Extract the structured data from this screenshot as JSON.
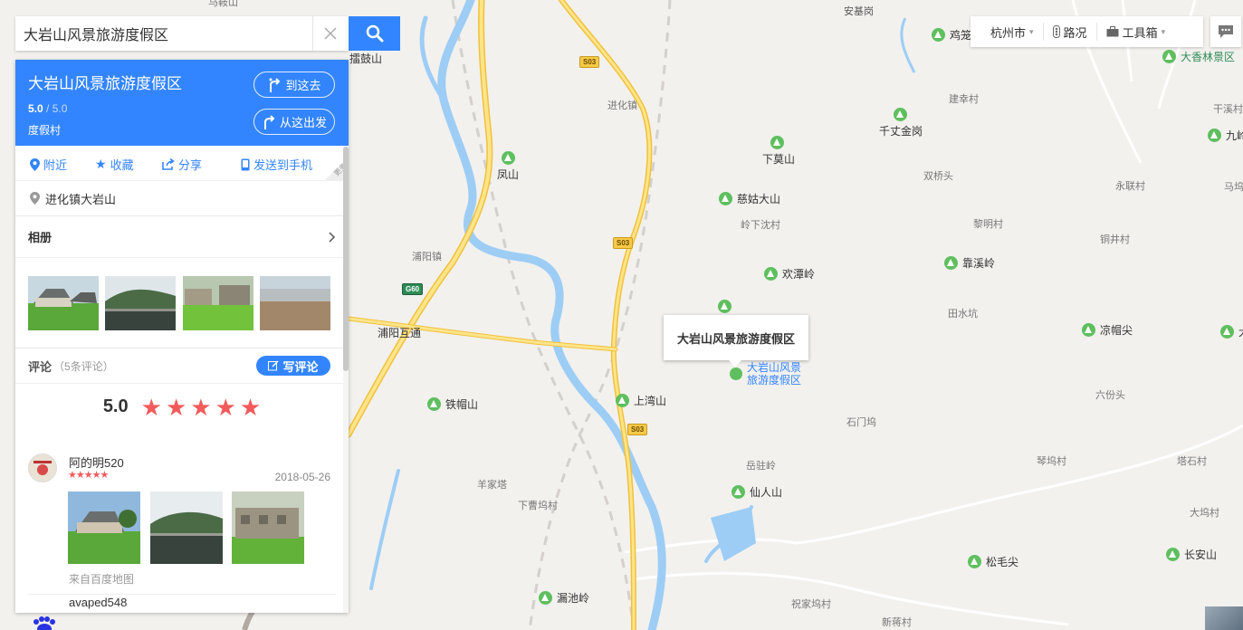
{
  "search": {
    "value": "大岩山风景旅游度假区"
  },
  "place": {
    "name": "大岩山风景旅游度假区",
    "score": "5.0",
    "score_max": "/ 5.0",
    "type": "度假村",
    "go_here": "到这去",
    "from_here": "从这出发",
    "address": "进化镇大岩山"
  },
  "actions": {
    "nearby": "附近",
    "favorite": "收藏",
    "share": "分享",
    "send_phone": "发送到手机",
    "more": "更多"
  },
  "album": {
    "title": "相册"
  },
  "comments": {
    "title": "评论",
    "count": "（5条评论）",
    "write": "写评论",
    "score": "5.0",
    "stars": 5,
    "items": [
      {
        "user": "阿的明520",
        "rating": 5,
        "date": "2018-05-26",
        "source": "来自百度地图"
      }
    ],
    "next_user": "avaped548"
  },
  "toolbar": {
    "city": "杭州市",
    "traffic": "路况",
    "tools": "工具箱"
  },
  "map": {
    "tooltip": "大岩山风景旅游度假区",
    "selected_line1": "大岩山风景",
    "selected_line2": "旅游度假区",
    "pois": {
      "fengshan": "凤山",
      "xiamoshan": "下莫山",
      "ciguda": "慈姑大山",
      "huantanling": "欢潭岭",
      "qianzhangjingang": "千丈金岗",
      "kaoxiling": "靠溪岭",
      "tiemaoshan": "铁帽山",
      "shangwanshan": "上湾山",
      "xianrenshan": "仙人山",
      "liangmaojian": "凉帽尖",
      "songmaojian": "松毛尖",
      "changanshan": "长安山",
      "louchiling": "漏池岭",
      "jilong": "鸡笼",
      "daxianglin": "大香林景区",
      "jiuling": "九岭",
      "east": "大"
    },
    "villages": {
      "jinhuazhen": "进化镇",
      "puyangzhen": "浦阳镇",
      "puyanghutong": "浦阳互通",
      "yangjiata": "羊家塔",
      "xiacaowucun": "下曹坞村",
      "lingxiachencun": "岭下沈村",
      "jianxingcun": "建幸村",
      "shuangqiaotou": "双桥头",
      "limingcun": "黎明村",
      "yongliancun": "永联村",
      "tongjingcun": "铜井村",
      "tianshuikeng": "田水坑",
      "liufentou": "六份头",
      "shimenwu": "石门坞",
      "yuezhuling": "岳驻岭",
      "qinwucun": "琴坞村",
      "tashicun": "塔石村",
      "dawucun": "大坞村",
      "zhujiawucun": "祝家坞村",
      "xinjiangcun": "新蒋村",
      "anjicun": "安基岗",
      "maanshan": "马鞍山",
      "leigushan": "擂鼓山",
      "ganxicun": "干溪村",
      "majiacun": "马坞"
    },
    "shields": {
      "s03": "S03",
      "g60": "G60"
    }
  }
}
